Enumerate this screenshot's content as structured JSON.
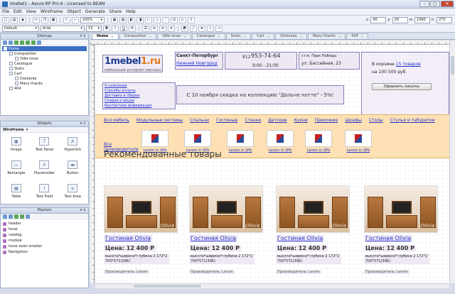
{
  "window": {
    "title": "Imebel1 - Axure RP Pro 6 : Licensed to BEAN"
  },
  "menu": [
    "File",
    "Edit",
    "View",
    "Wireframe",
    "Object",
    "Generate",
    "Share",
    "Help"
  ],
  "toolbar": {
    "zoom": "100%",
    "style": "Default",
    "font": "Arial",
    "size": "13",
    "x_label": "x:",
    "x_val": "40",
    "y_label": "y:",
    "y_val": "20",
    "w_label": "w:",
    "w_val": "1060",
    "h_label": "h:",
    "h_val": "270"
  },
  "sitemap": {
    "title": "Sitemap",
    "items": [
      {
        "label": "Home",
        "indent": 0
      },
      {
        "label": "Composition",
        "indent": 1
      },
      {
        "label": "Odle tovar",
        "indent": 2
      },
      {
        "label": "Catalogue",
        "indent": 1
      },
      {
        "label": "Static",
        "indent": 1
      },
      {
        "label": "Cart",
        "indent": 1
      },
      {
        "label": "Dostavka",
        "indent": 2
      },
      {
        "label": "Many thanks",
        "indent": 2
      },
      {
        "label": "404",
        "indent": 1
      }
    ]
  },
  "widgets": {
    "title": "Widgets",
    "library": "Wireframe",
    "items": [
      {
        "label": "Image",
        "glyph": "▣"
      },
      {
        "label": "Text Panel",
        "glyph": "T"
      },
      {
        "label": "Hyperlink",
        "glyph": "A"
      },
      {
        "label": "Rectangle",
        "glyph": "▭"
      },
      {
        "label": "Placeholder",
        "glyph": "✕"
      },
      {
        "label": "Button",
        "glyph": "▬"
      },
      {
        "label": "Table",
        "glyph": "▦"
      },
      {
        "label": "Text Field",
        "glyph": "I"
      },
      {
        "label": "Text Area",
        "glyph": "≡"
      }
    ]
  },
  "masters": {
    "title": "Masters",
    "items": [
      "header",
      "tovar",
      "catalog",
      "module",
      "tovar even smaller",
      "Navigation"
    ]
  },
  "tabs": [
    "Home",
    "Composition",
    "Odle tovar",
    "Catalogue",
    "Static",
    "Cart",
    "Dostavka",
    "Many thanks",
    "404"
  ],
  "page": {
    "logo_main": "1mebel",
    "logo_accent": "1.ru",
    "logo_tagline": "мебельный интернет-магазин",
    "city1": "Санкт-Петербург",
    "city2": "Нижний Новгород",
    "phone_prefix": "812",
    "phone": "953-74-64",
    "hours": "9:00 - 21:00",
    "address1": "ст.м. Парк Победы",
    "address2": "ул. Бассейная, 23",
    "cart_line1": "В корзине",
    "cart_count": "15 товаров",
    "cart_line2": "на 100 500 руб.",
    "cart_button": "Оформить покупку",
    "info_links": [
      "О компании",
      "Способы оплаты",
      "Доставка и сборка",
      "Скидки и акции",
      "Контактная информация"
    ],
    "promo": "С 10 ноября скидка на  коллекцию \"Дольче нотте\" - 5%!",
    "nav": [
      "Вся мебель",
      "Модульные системы",
      "Спальни",
      "Гостиные",
      "Стенки",
      "Детские",
      "Кухни",
      "Прихожие",
      "Шкафы",
      "Стулья и табуретки"
    ],
    "nav_extra": "Столы",
    "all_makers": "Все производители",
    "brand_label": "Lerom in SPb",
    "section_title": "Рекомендованные товары",
    "products": [
      {
        "name": "Гостиная Olivia",
        "price": "Цена: 12 400 Р",
        "dims": "высота*ширина*глубина 2 172*2 700*571(396)",
        "maker_label": "Производитель:",
        "maker": "Lerom"
      },
      {
        "name": "Гостиная Olivia",
        "price": "Цена: 12 400 Р",
        "dims": "высота*ширина*глубина 2 172*2 700*571(396)",
        "maker_label": "Производитель:",
        "maker": "Lerom"
      },
      {
        "name": "Гостиная Olivia",
        "price": "Цена: 12 400 Р",
        "dims": "высота*ширина*глубина 2 172*2 700*571(396)",
        "maker_label": "Производитель:",
        "maker": "Lerom"
      },
      {
        "name": "Гостиная Olivia",
        "price": "Цена: 12 400 Р",
        "dims": "высота*ширина*глубина 2 172*2 700*571(396)",
        "maker_label": "Производитель:",
        "maker": "Lerom"
      }
    ],
    "watermark": "Olivia"
  },
  "colors": {
    "accent": "#3a6ec3",
    "link": "#2233cc",
    "nav_bg": "#fde1b4",
    "dynamic_panel": "#e8def0"
  }
}
